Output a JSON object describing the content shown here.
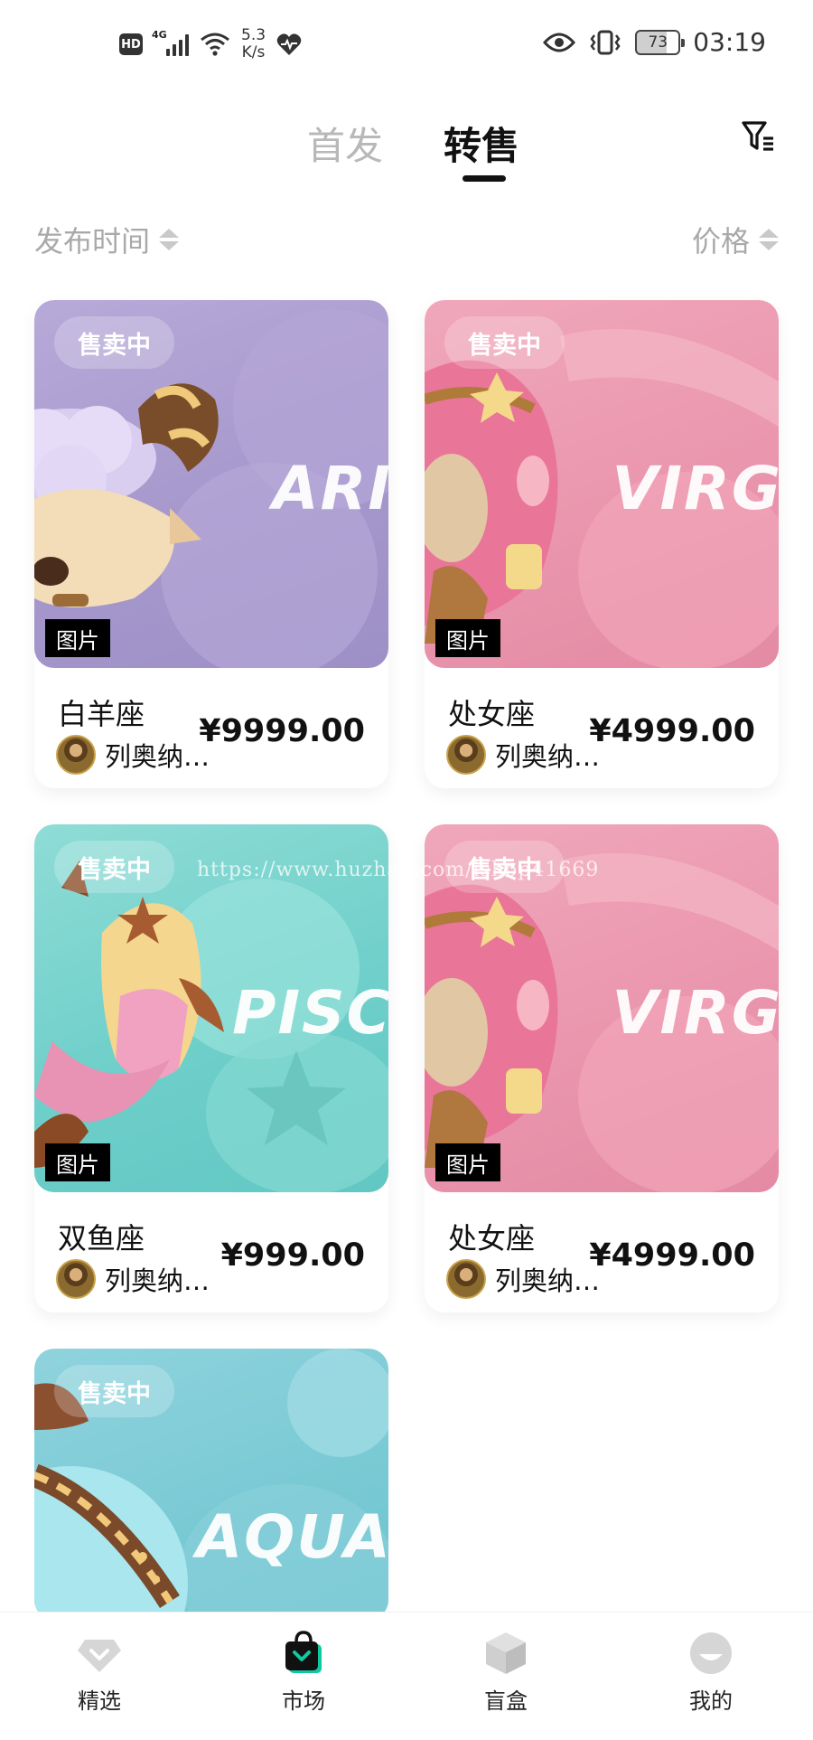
{
  "status_bar": {
    "hd": "HD",
    "network": "4G",
    "speed_value": "5.3",
    "speed_unit": "K/s",
    "battery": "73",
    "time": "03:19"
  },
  "tabs": {
    "first_release": "首发",
    "resale": "转售",
    "active": "resale"
  },
  "sort": {
    "time_label": "发布时间",
    "price_label": "价格"
  },
  "cards": [
    {
      "status": "售卖中",
      "sign_text": "ARI",
      "type": "图片",
      "name": "白羊座",
      "owner": "列奥纳…",
      "price": "¥9999.00",
      "theme": "purple"
    },
    {
      "status": "售卖中",
      "sign_text": "VIRG",
      "type": "图片",
      "name": "处女座",
      "owner": "列奥纳…",
      "price": "¥4999.00",
      "theme": "pink"
    },
    {
      "status": "售卖中",
      "sign_text": "PISC",
      "type": "图片",
      "name": "双鱼座",
      "owner": "列奥纳…",
      "price": "¥999.00",
      "theme": "teal"
    },
    {
      "status": "售卖中",
      "sign_text": "VIRG",
      "type": "图片",
      "name": "处女座",
      "owner": "列奥纳…",
      "price": "¥4999.00",
      "theme": "pink"
    },
    {
      "status": "售卖中",
      "sign_text": "AQUA",
      "theme": "cyan"
    }
  ],
  "watermark": "https://www.huzhan.com/ishop41669",
  "bottom_nav": [
    {
      "label": "精选",
      "icon": "diamond-icon",
      "active": false
    },
    {
      "label": "市场",
      "icon": "shopping-bag-icon",
      "active": true
    },
    {
      "label": "盲盒",
      "icon": "cube-icon",
      "active": false
    },
    {
      "label": "我的",
      "icon": "profile-face-icon",
      "active": false
    }
  ],
  "colors": {
    "accent": "#11c9a0",
    "active_tab": "#111111",
    "inactive_tab": "#b8b8b8",
    "sort_text": "#a9a9a9",
    "purple_card": "#a698cc",
    "pink_card": "#ea96ae",
    "teal_card": "#6fcfca",
    "cyan_card": "#76c8d3"
  }
}
